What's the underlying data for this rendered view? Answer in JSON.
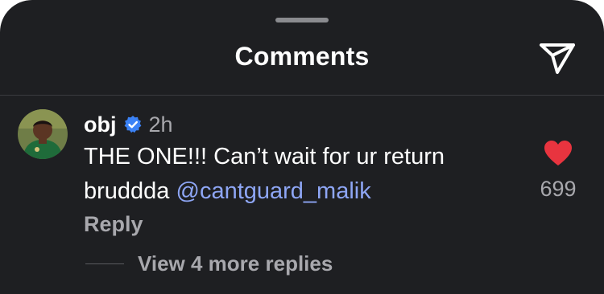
{
  "sheet": {
    "title": "Comments"
  },
  "comment": {
    "username": "obj",
    "time": "2h",
    "text_parts": [
      "THE ONE!!! Can’t wait for ur return bruddda ",
      "@cantguard_malik"
    ],
    "likes": "699",
    "reply_label": "Reply",
    "view_replies_label": "View 4 more replies"
  },
  "icons": {
    "share": "paper-plane-icon",
    "verified": "verified-badge-icon",
    "like": "heart-icon"
  },
  "colors": {
    "background": "#1e1f22",
    "mention": "#8ea6f5",
    "heart": "#e8343f",
    "verified": "#3b82f6",
    "muted_text": "#a8a8ad"
  }
}
